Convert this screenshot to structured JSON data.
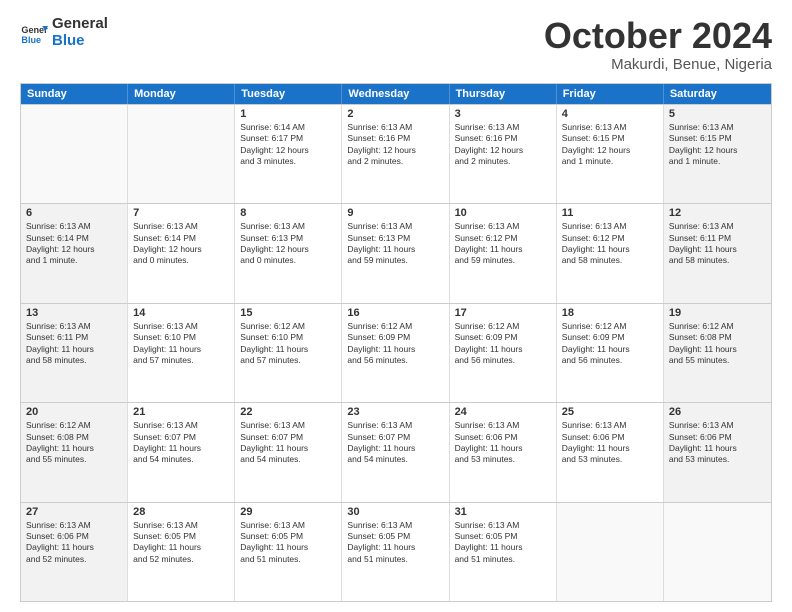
{
  "header": {
    "logo_general": "General",
    "logo_blue": "Blue",
    "month_title": "October 2024",
    "location": "Makurdi, Benue, Nigeria"
  },
  "days_of_week": [
    "Sunday",
    "Monday",
    "Tuesday",
    "Wednesday",
    "Thursday",
    "Friday",
    "Saturday"
  ],
  "weeks": [
    [
      {
        "day": "",
        "text": "",
        "empty": true
      },
      {
        "day": "",
        "text": "",
        "empty": true
      },
      {
        "day": "1",
        "text": "Sunrise: 6:14 AM\nSunset: 6:17 PM\nDaylight: 12 hours\nand 3 minutes.",
        "shaded": false
      },
      {
        "day": "2",
        "text": "Sunrise: 6:13 AM\nSunset: 6:16 PM\nDaylight: 12 hours\nand 2 minutes.",
        "shaded": false
      },
      {
        "day": "3",
        "text": "Sunrise: 6:13 AM\nSunset: 6:16 PM\nDaylight: 12 hours\nand 2 minutes.",
        "shaded": false
      },
      {
        "day": "4",
        "text": "Sunrise: 6:13 AM\nSunset: 6:15 PM\nDaylight: 12 hours\nand 1 minute.",
        "shaded": false
      },
      {
        "day": "5",
        "text": "Sunrise: 6:13 AM\nSunset: 6:15 PM\nDaylight: 12 hours\nand 1 minute.",
        "shaded": true
      }
    ],
    [
      {
        "day": "6",
        "text": "Sunrise: 6:13 AM\nSunset: 6:14 PM\nDaylight: 12 hours\nand 1 minute.",
        "shaded": true
      },
      {
        "day": "7",
        "text": "Sunrise: 6:13 AM\nSunset: 6:14 PM\nDaylight: 12 hours\nand 0 minutes.",
        "shaded": false
      },
      {
        "day": "8",
        "text": "Sunrise: 6:13 AM\nSunset: 6:13 PM\nDaylight: 12 hours\nand 0 minutes.",
        "shaded": false
      },
      {
        "day": "9",
        "text": "Sunrise: 6:13 AM\nSunset: 6:13 PM\nDaylight: 11 hours\nand 59 minutes.",
        "shaded": false
      },
      {
        "day": "10",
        "text": "Sunrise: 6:13 AM\nSunset: 6:12 PM\nDaylight: 11 hours\nand 59 minutes.",
        "shaded": false
      },
      {
        "day": "11",
        "text": "Sunrise: 6:13 AM\nSunset: 6:12 PM\nDaylight: 11 hours\nand 58 minutes.",
        "shaded": false
      },
      {
        "day": "12",
        "text": "Sunrise: 6:13 AM\nSunset: 6:11 PM\nDaylight: 11 hours\nand 58 minutes.",
        "shaded": true
      }
    ],
    [
      {
        "day": "13",
        "text": "Sunrise: 6:13 AM\nSunset: 6:11 PM\nDaylight: 11 hours\nand 58 minutes.",
        "shaded": true
      },
      {
        "day": "14",
        "text": "Sunrise: 6:13 AM\nSunset: 6:10 PM\nDaylight: 11 hours\nand 57 minutes.",
        "shaded": false
      },
      {
        "day": "15",
        "text": "Sunrise: 6:12 AM\nSunset: 6:10 PM\nDaylight: 11 hours\nand 57 minutes.",
        "shaded": false
      },
      {
        "day": "16",
        "text": "Sunrise: 6:12 AM\nSunset: 6:09 PM\nDaylight: 11 hours\nand 56 minutes.",
        "shaded": false
      },
      {
        "day": "17",
        "text": "Sunrise: 6:12 AM\nSunset: 6:09 PM\nDaylight: 11 hours\nand 56 minutes.",
        "shaded": false
      },
      {
        "day": "18",
        "text": "Sunrise: 6:12 AM\nSunset: 6:09 PM\nDaylight: 11 hours\nand 56 minutes.",
        "shaded": false
      },
      {
        "day": "19",
        "text": "Sunrise: 6:12 AM\nSunset: 6:08 PM\nDaylight: 11 hours\nand 55 minutes.",
        "shaded": true
      }
    ],
    [
      {
        "day": "20",
        "text": "Sunrise: 6:12 AM\nSunset: 6:08 PM\nDaylight: 11 hours\nand 55 minutes.",
        "shaded": true
      },
      {
        "day": "21",
        "text": "Sunrise: 6:13 AM\nSunset: 6:07 PM\nDaylight: 11 hours\nand 54 minutes.",
        "shaded": false
      },
      {
        "day": "22",
        "text": "Sunrise: 6:13 AM\nSunset: 6:07 PM\nDaylight: 11 hours\nand 54 minutes.",
        "shaded": false
      },
      {
        "day": "23",
        "text": "Sunrise: 6:13 AM\nSunset: 6:07 PM\nDaylight: 11 hours\nand 54 minutes.",
        "shaded": false
      },
      {
        "day": "24",
        "text": "Sunrise: 6:13 AM\nSunset: 6:06 PM\nDaylight: 11 hours\nand 53 minutes.",
        "shaded": false
      },
      {
        "day": "25",
        "text": "Sunrise: 6:13 AM\nSunset: 6:06 PM\nDaylight: 11 hours\nand 53 minutes.",
        "shaded": false
      },
      {
        "day": "26",
        "text": "Sunrise: 6:13 AM\nSunset: 6:06 PM\nDaylight: 11 hours\nand 53 minutes.",
        "shaded": true
      }
    ],
    [
      {
        "day": "27",
        "text": "Sunrise: 6:13 AM\nSunset: 6:06 PM\nDaylight: 11 hours\nand 52 minutes.",
        "shaded": true
      },
      {
        "day": "28",
        "text": "Sunrise: 6:13 AM\nSunset: 6:05 PM\nDaylight: 11 hours\nand 52 minutes.",
        "shaded": false
      },
      {
        "day": "29",
        "text": "Sunrise: 6:13 AM\nSunset: 6:05 PM\nDaylight: 11 hours\nand 51 minutes.",
        "shaded": false
      },
      {
        "day": "30",
        "text": "Sunrise: 6:13 AM\nSunset: 6:05 PM\nDaylight: 11 hours\nand 51 minutes.",
        "shaded": false
      },
      {
        "day": "31",
        "text": "Sunrise: 6:13 AM\nSunset: 6:05 PM\nDaylight: 11 hours\nand 51 minutes.",
        "shaded": false
      },
      {
        "day": "",
        "text": "",
        "empty": true
      },
      {
        "day": "",
        "text": "",
        "empty": true,
        "shaded": true
      }
    ]
  ]
}
